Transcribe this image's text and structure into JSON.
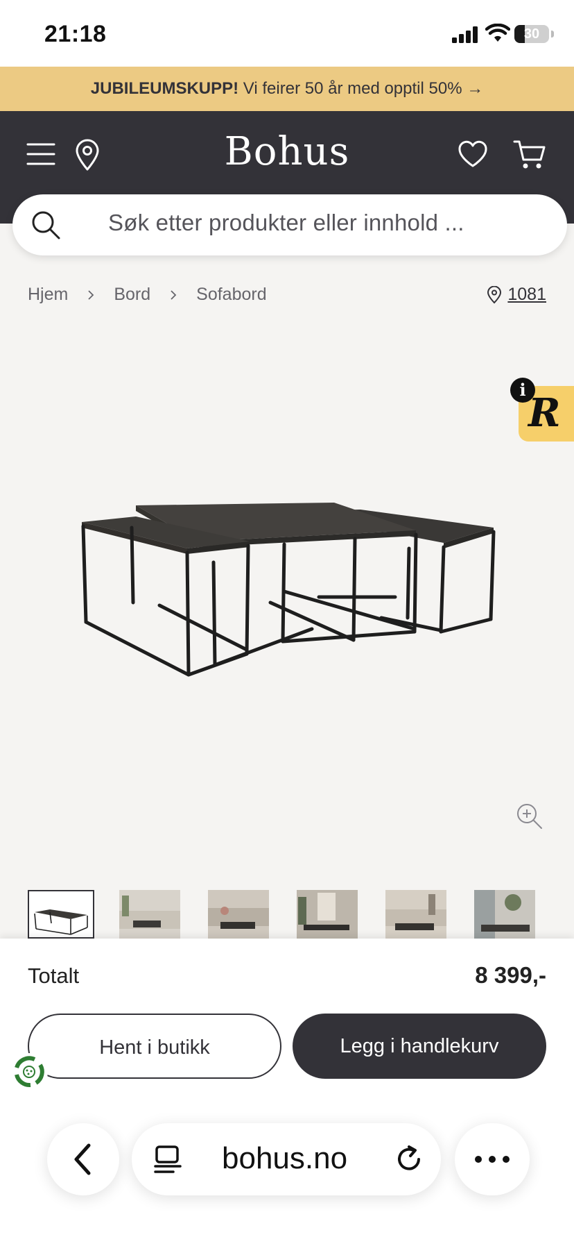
{
  "status_bar": {
    "time": "21:18",
    "battery": "30",
    "battery_level": 0.3
  },
  "promo": {
    "bold": "JUBILEUMSKUPP!",
    "text": " Vi feirer 50 år med opptil 50% →"
  },
  "header": {
    "logo": "Bohus"
  },
  "search": {
    "placeholder": "Søk etter produkter eller innhold ..."
  },
  "breadcrumb": {
    "items": [
      "Hjem",
      "Bord",
      "Sofabord"
    ],
    "store_code": "1081"
  },
  "badge": {
    "letter": "R",
    "info": "i"
  },
  "summary": {
    "total_label": "Totalt",
    "total_price": "8 399,-"
  },
  "actions": {
    "pickup": "Hent i butikk",
    "add_to_cart": "Legg i handlekurv"
  },
  "browser": {
    "url": "bohus.no"
  },
  "colors": {
    "dark": "#333238",
    "promo": "#ecca83",
    "badge": "#f6cf6a",
    "eco": "#2e7d32"
  }
}
